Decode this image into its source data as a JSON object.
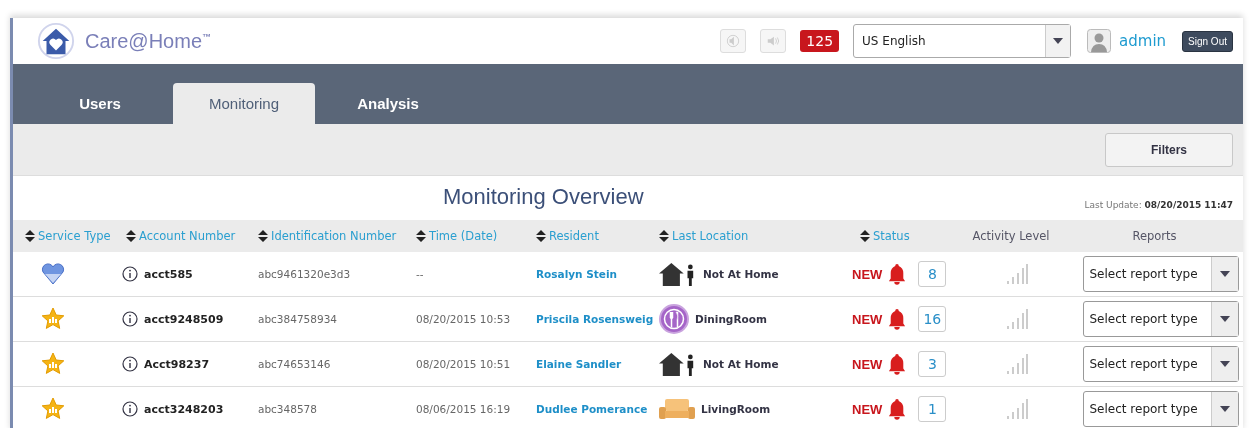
{
  "header": {
    "logo": "Care@Home",
    "trademark": "™",
    "alert_count": "125",
    "language": "US English",
    "user": "admin",
    "sign_out": "Sign Out"
  },
  "tabs": [
    {
      "label": "Users",
      "selected": false
    },
    {
      "label": "Monitoring",
      "selected": true
    },
    {
      "label": "Analysis",
      "selected": false
    }
  ],
  "toolbar": {
    "filters": "Filters"
  },
  "overview": {
    "title": "Monitoring Overview",
    "last_update_label": "Last Update:",
    "last_update": "08/20/2015 11:47"
  },
  "table": {
    "columns": [
      {
        "label": "Service Type",
        "sortable": true
      },
      {
        "label": "Account Number",
        "sortable": true
      },
      {
        "label": "Identification Number",
        "sortable": true
      },
      {
        "label": "Time (Date)",
        "sortable": true
      },
      {
        "label": "Resident",
        "sortable": true
      },
      {
        "label": "Last Location",
        "sortable": true
      },
      {
        "label": "Status",
        "sortable": true
      },
      {
        "label": "Activity Level",
        "sortable": false
      },
      {
        "label": "Reports",
        "sortable": false
      }
    ],
    "rows": [
      {
        "service": {
          "kind": "heart"
        },
        "account": "acct585",
        "id": "abc9461320e3d3",
        "time": "--",
        "resident": "Rosalyn Stein",
        "location": {
          "kind": "away",
          "label": "Not At Home"
        },
        "status": "NEW",
        "count": "8",
        "report": "Select report type"
      },
      {
        "service": {
          "kind": "star"
        },
        "account": "acct9248509",
        "id": "abc384758934",
        "time": "08/20/2015 10:53",
        "resident": "Priscila Rosensweig",
        "location": {
          "kind": "dining",
          "label": "DiningRoom"
        },
        "status": "NEW",
        "count": "16",
        "report": "Select report type"
      },
      {
        "service": {
          "kind": "star"
        },
        "account": "Acct98237",
        "id": "abc74653146",
        "time": "08/20/2015 10:51",
        "resident": "Elaine Sandler",
        "location": {
          "kind": "away",
          "label": "Not At Home"
        },
        "status": "NEW",
        "count": "3",
        "report": "Select report type"
      },
      {
        "service": {
          "kind": "star"
        },
        "account": "acct3248203",
        "id": "abc348578",
        "time": "08/06/2015 16:19",
        "resident": "Dudlee Pomerance",
        "location": {
          "kind": "living",
          "label": "LivingRoom"
        },
        "status": "NEW",
        "count": "1",
        "report": "Select report type"
      }
    ]
  }
}
